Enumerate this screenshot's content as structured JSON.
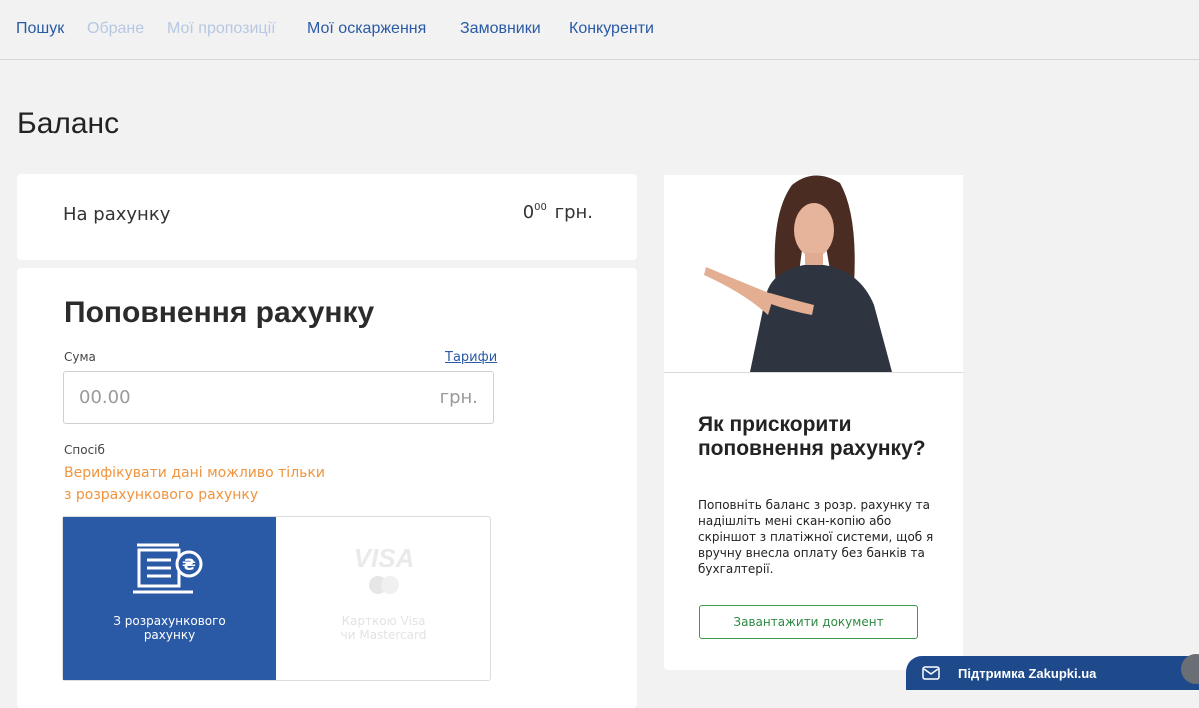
{
  "nav": {
    "items": [
      {
        "label": "Пошук",
        "state": "active"
      },
      {
        "label": "Обране",
        "state": "disabled"
      },
      {
        "label": "Мої пропозиції",
        "state": "disabled"
      },
      {
        "label": "Мої оскарження",
        "state": "active"
      },
      {
        "label": "Замовники",
        "state": "active"
      },
      {
        "label": "Конкуренти",
        "state": "active"
      }
    ]
  },
  "page": {
    "title": "Баланс"
  },
  "balance": {
    "label": "На рахунку",
    "value_int": "0",
    "value_cents": "00",
    "currency": "грн."
  },
  "topup": {
    "title": "Поповнення рахунку",
    "sum_label": "Сума",
    "tariffs_link": "Тарифи",
    "sum_placeholder": "00.00",
    "sum_currency": "грн.",
    "method_label": "Спосіб",
    "warning_line1": "Верифікувати дані можливо тільки",
    "warning_line2": "з розрахункового рахунку",
    "methods": [
      {
        "line1": "З розрахункового",
        "line2": "рахунку",
        "icon": "bank-transfer-icon",
        "selected": true
      },
      {
        "line1": "Карткою Visa",
        "line2": "чи Mastercard",
        "icon": "visa-mastercard-icon",
        "selected": false
      }
    ]
  },
  "promo": {
    "title": "Як прискорити поповнення рахунку?",
    "text": "Поповніть баланс з розр. рахунку та надішліть мені скан-копію або скріншот з платіжної системи, щоб я вручну внесла оплату без банків та бухгалтерії.",
    "button_label": "Завантажити документ"
  },
  "support": {
    "label": "Підтримка Zakupki.ua"
  },
  "colors": {
    "accent": "#2a5aa6",
    "nav_disabled": "#b6c8e3",
    "warning": "#f0943e",
    "success": "#3a9a4e",
    "support_bar": "#1e4a8c"
  }
}
